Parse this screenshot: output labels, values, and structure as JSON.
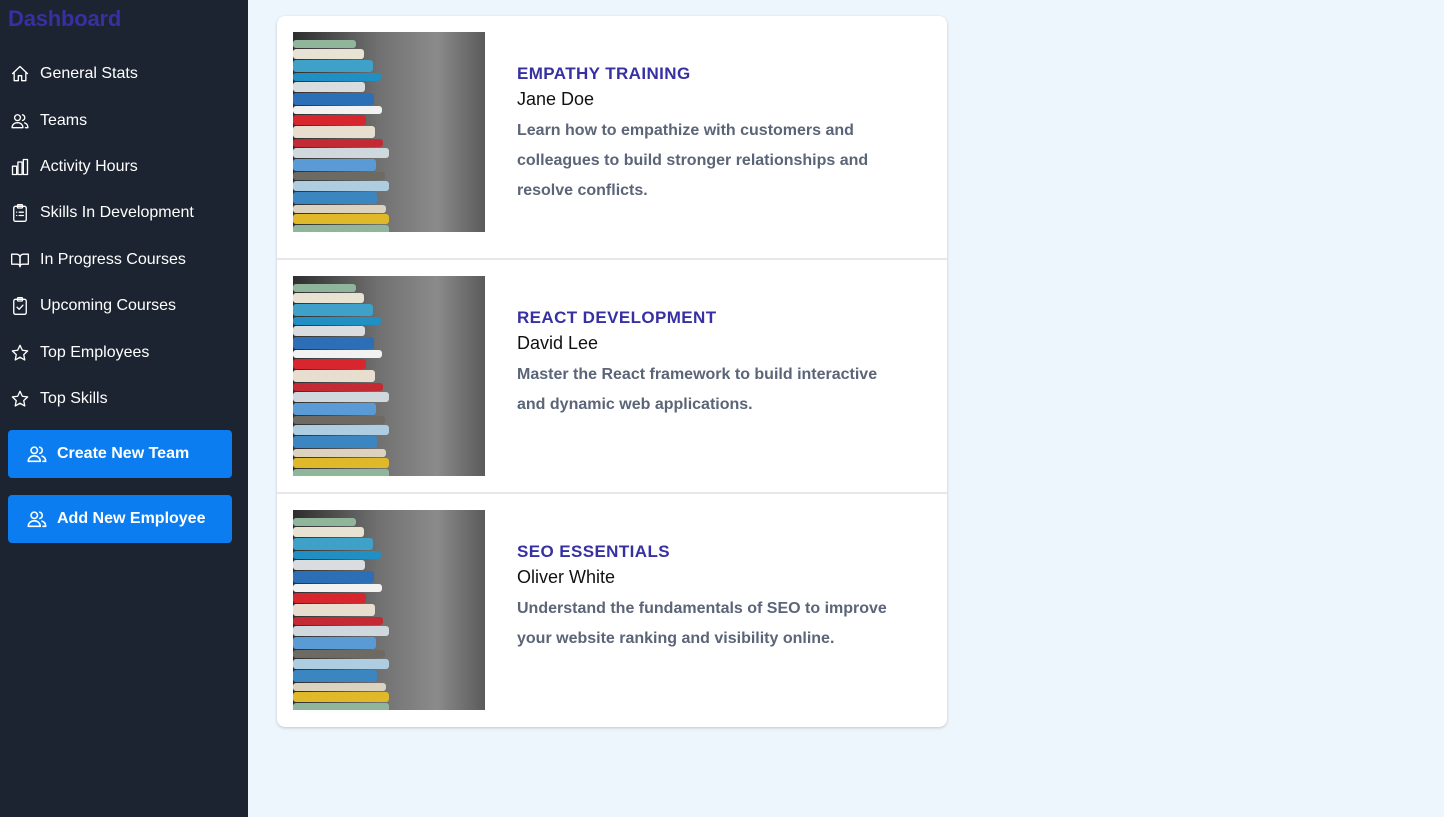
{
  "sidebar": {
    "brand": "Dashboard",
    "items": [
      {
        "label": "General Stats",
        "icon": "home-icon"
      },
      {
        "label": "Teams",
        "icon": "users-icon"
      },
      {
        "label": "Activity Hours",
        "icon": "bar-chart-icon"
      },
      {
        "label": "Skills In Development",
        "icon": "clipboard-list-icon"
      },
      {
        "label": "In Progress Courses",
        "icon": "open-book-icon"
      },
      {
        "label": "Upcoming Courses",
        "icon": "clipboard-check-icon"
      },
      {
        "label": "Top Employees",
        "icon": "star-icon"
      },
      {
        "label": "Top Skills",
        "icon": "star-icon"
      }
    ],
    "create_team_label": "Create New Team",
    "add_employee_label": "Add New Employee"
  },
  "courses": [
    {
      "title": "EMPATHY TRAINING",
      "instructor": "Jane Doe",
      "description": "Learn how to empathize with customers and colleagues to build stronger relationships and resolve conflicts."
    },
    {
      "title": "REACT DEVELOPMENT",
      "instructor": "David Lee",
      "description": "Master the React framework to build interactive and dynamic web applications."
    },
    {
      "title": "SEO ESSENTIALS",
      "instructor": "Oliver White",
      "description": "Understand the fundamentals of SEO to improve your website ranking and visibility online."
    }
  ],
  "colors": {
    "sidebar_bg": "#1b2430",
    "brand": "#3730a3",
    "button": "#0b7df0",
    "page_bg": "#eef6fd",
    "course_title": "#3730a3",
    "description": "#5b6577"
  }
}
